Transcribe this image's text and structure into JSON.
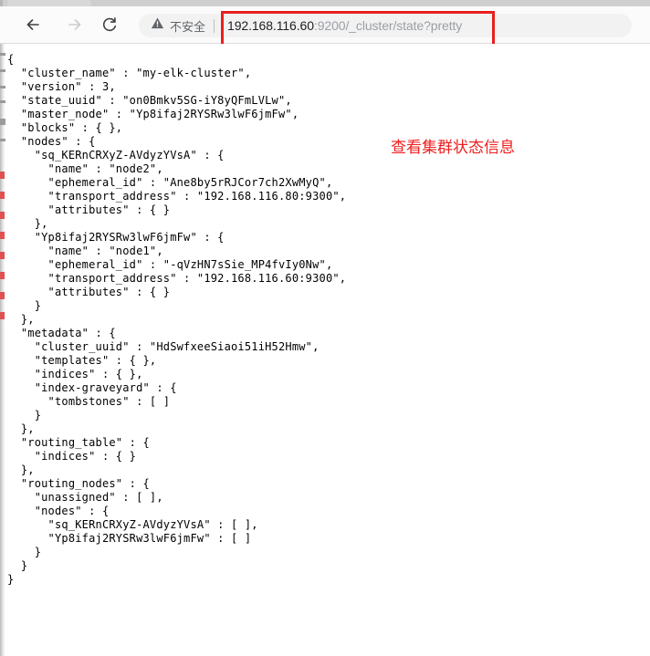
{
  "browser": {
    "tab_strip": {
      "tab_placeholder_name": "inactive-tab"
    },
    "toolbar": {
      "back_icon": "back-arrow-icon",
      "forward_icon": "forward-arrow-icon",
      "reload_icon": "reload-icon",
      "security_icon": "warning-triangle-icon",
      "security_label": "不安全",
      "url_host": "192.168.116.60",
      "url_rest": ":9200/_cluster/state?pretty",
      "url_full": "192.168.116.60:9200/_cluster/state?pretty"
    },
    "highlight_color": "#e81f1f"
  },
  "annotation": {
    "text": "查看集群状态信息",
    "color": "#ef2020"
  },
  "response": {
    "body": "{\n  \"cluster_name\" : \"my-elk-cluster\",\n  \"version\" : 3,\n  \"state_uuid\" : \"on0Bmkv5SG-iY8yQFmLVLw\",\n  \"master_node\" : \"Yp8ifaj2RYSRw3lwF6jmFw\",\n  \"blocks\" : { },\n  \"nodes\" : {\n    \"sq_KERnCRXyZ-AVdyzYVsA\" : {\n      \"name\" : \"node2\",\n      \"ephemeral_id\" : \"Ane8by5rRJCor7ch2XwMyQ\",\n      \"transport_address\" : \"192.168.116.80:9300\",\n      \"attributes\" : { }\n    },\n    \"Yp8ifaj2RYSRw3lwF6jmFw\" : {\n      \"name\" : \"node1\",\n      \"ephemeral_id\" : \"-qVzHN7sSie_MP4fvIy0Nw\",\n      \"transport_address\" : \"192.168.116.60:9300\",\n      \"attributes\" : { }\n    }\n  },\n  \"metadata\" : {\n    \"cluster_uuid\" : \"HdSwfxeeSiaoi51iH52Hmw\",\n    \"templates\" : { },\n    \"indices\" : { },\n    \"index-graveyard\" : {\n      \"tombstones\" : [ ]\n    }\n  },\n  \"routing_table\" : {\n    \"indices\" : { }\n  },\n  \"routing_nodes\" : {\n    \"unassigned\" : [ ],\n    \"nodes\" : {\n      \"sq_KERnCRXyZ-AVdyzYVsA\" : [ ],\n      \"Yp8ifaj2RYSRw3lwF6jmFw\" : [ ]\n    }\n  }\n}",
    "fields": {
      "cluster_name": "my-elk-cluster",
      "version": 3,
      "state_uuid": "on0Bmkv5SG-iY8yQFmLVLw",
      "master_node": "Yp8ifaj2RYSRw3lwF6jmFw",
      "blocks": "{ }",
      "nodes": [
        {
          "id": "sq_KERnCRXyZ-AVdyzYVsA",
          "name": "node2",
          "ephemeral_id": "Ane8by5rRJCor7ch2XwMyQ",
          "transport_address": "192.168.116.80:9300",
          "attributes": "{ }"
        },
        {
          "id": "Yp8ifaj2RYSRw3lwF6jmFw",
          "name": "node1",
          "ephemeral_id": "-qVzHN7sSie_MP4fvIy0Nw",
          "transport_address": "192.168.116.60:9300",
          "attributes": "{ }"
        }
      ],
      "metadata": {
        "cluster_uuid": "HdSwfxeeSiaoi51iH52Hmw",
        "templates": "{ }",
        "indices": "{ }",
        "index_graveyard_tombstones": "[ ]"
      },
      "routing_table_indices": "{ }",
      "routing_nodes": {
        "unassigned": "[ ]",
        "nodes": [
          {
            "id": "sq_KERnCRXyZ-AVdyzYVsA",
            "shards": "[ ]"
          },
          {
            "id": "Yp8ifaj2RYSRw3lwF6jmFw",
            "shards": "[ ]"
          }
        ]
      }
    }
  }
}
